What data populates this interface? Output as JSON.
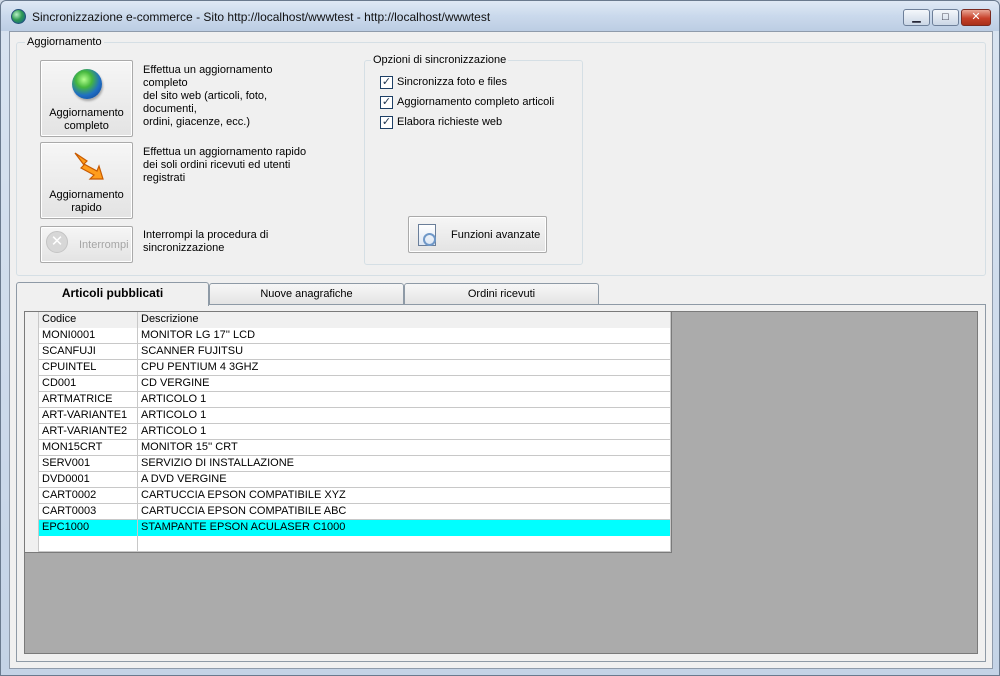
{
  "window": {
    "title": "Sincronizzazione e-commerce - Sito http://localhost/wwwtest - http://localhost/wwwtest",
    "min_glyph": "▁",
    "max_glyph": "□",
    "close_glyph": "✕"
  },
  "update_group": {
    "label": "Aggiornamento",
    "full": {
      "label_1": "Aggiornamento",
      "label_2": "completo",
      "desc_1": "Effettua un aggiornamento completo",
      "desc_2": "del sito web (articoli, foto, documenti,",
      "desc_3": "ordini, giacenze, ecc.)",
      "icon": "globe-icon"
    },
    "quick": {
      "label_1": "Aggiornamento",
      "label_2": "rapido",
      "desc_1": "Effettua un aggiornamento rapido",
      "desc_2": "dei soli ordini ricevuti ed utenti",
      "desc_3": "registrati",
      "icon": "lightning-icon"
    },
    "stop": {
      "label": "Interrompi",
      "desc_1": "Interrompi la procedura di",
      "desc_2": "sincronizzazione",
      "glyph": "✕",
      "disabled": true
    }
  },
  "sync_options": {
    "label": "Opzioni di sincronizzazione",
    "check_glyph": "✓",
    "options": [
      {
        "label": "Sincronizza foto e files",
        "checked": true
      },
      {
        "label": "Aggiornamento completo articoli",
        "checked": true
      },
      {
        "label": "Elabora richieste web",
        "checked": true
      }
    ],
    "advanced_button": "Funzioni avanzate"
  },
  "tabs": [
    {
      "label": "Articoli pubblicati",
      "active": true
    },
    {
      "label": "Nuove anagrafiche",
      "active": false
    },
    {
      "label": "Ordini ricevuti",
      "active": false
    }
  ],
  "grid": {
    "columns": [
      "Codice",
      "Descrizione"
    ],
    "rows": [
      {
        "code": "MONI0001",
        "desc": "MONITOR LG 17'' LCD"
      },
      {
        "code": "SCANFUJI",
        "desc": "SCANNER FUJITSU"
      },
      {
        "code": "CPUINTEL",
        "desc": "CPU PENTIUM 4 3GHZ"
      },
      {
        "code": "CD001",
        "desc": "CD VERGINE"
      },
      {
        "code": "ARTMATRICE",
        "desc": "ARTICOLO 1"
      },
      {
        "code": "ART-VARIANTE1",
        "desc": "ARTICOLO 1"
      },
      {
        "code": "ART-VARIANTE2",
        "desc": "ARTICOLO 1"
      },
      {
        "code": "MON15CRT",
        "desc": "MONITOR 15'' CRT"
      },
      {
        "code": "SERV001",
        "desc": "SERVIZIO DI INSTALLAZIONE"
      },
      {
        "code": "DVD0001",
        "desc": "A DVD VERGINE"
      },
      {
        "code": "CART0002",
        "desc": "CARTUCCIA EPSON COMPATIBILE XYZ"
      },
      {
        "code": "CART0003",
        "desc": "CARTUCCIA EPSON COMPATIBILE ABC"
      },
      {
        "code": "EPC1000",
        "desc": "STAMPANTE EPSON ACULASER C1000",
        "selected": true
      },
      {
        "code": "",
        "desc": ""
      }
    ],
    "selected_color": "#00ffff"
  }
}
